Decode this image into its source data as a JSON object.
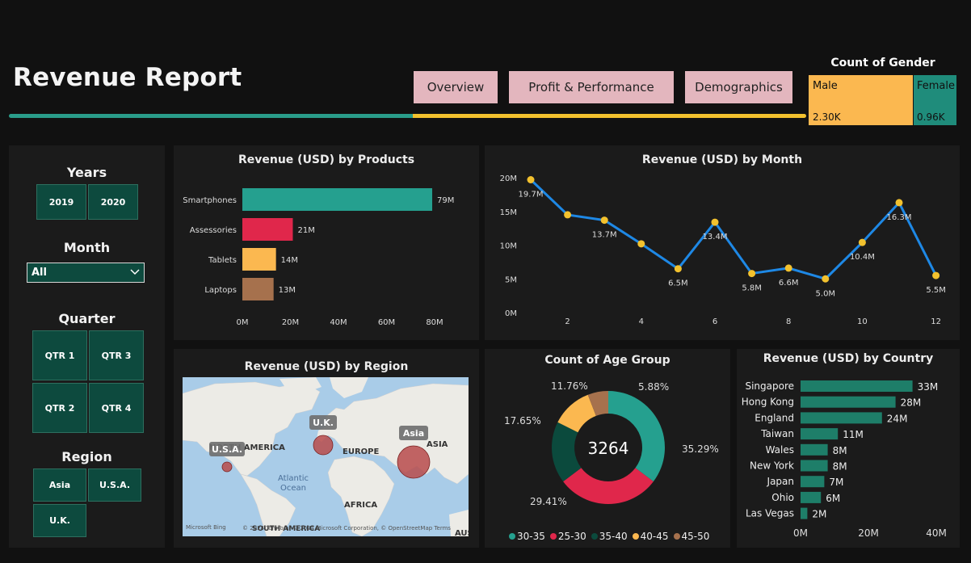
{
  "header": {
    "title": "Revenue Report",
    "nav": [
      "Overview",
      "Profit & Performance",
      "Demographics"
    ]
  },
  "gender": {
    "title": "Count of Gender",
    "male_label": "Male",
    "male_value": "2.30K",
    "female_label": "Female",
    "female_value": "0.96K",
    "male_color": "#fbb850",
    "female_color": "#1f8c7b"
  },
  "slicers": {
    "years_label": "Years",
    "years": [
      "2019",
      "2020"
    ],
    "month_label": "Month",
    "month_value": "All",
    "quarter_label": "Quarter",
    "quarters": [
      "QTR 1",
      "QTR 3",
      "QTR 2",
      "QTR 4"
    ],
    "region_label": "Region",
    "regions": [
      "Asia",
      "U.S.A.",
      "U.K."
    ]
  },
  "map": {
    "title": "Revenue (USD) by Region",
    "labels": {
      "na": "NORTH AMERICA",
      "eu": "EUROPE",
      "as": "ASIA",
      "af": "AFRICA",
      "sa": "SOUTH AMERICA",
      "ocean": "Atlantic\nOcean",
      "aus": "AUS"
    },
    "bubbles": [
      "U.S.A.",
      "U.K.",
      "Asia"
    ],
    "attribution": "© 2024 TomTom, © 2024 Microsoft Corporation, © OpenStreetMap  Terms",
    "bing": "Microsoft Bing"
  },
  "chart_data": [
    {
      "type": "bar",
      "title": "Revenue (USD) by Products",
      "categories": [
        "Smartphones",
        "Assessories",
        "Tablets",
        "Laptops"
      ],
      "values": [
        79,
        21,
        14,
        13
      ],
      "data_labels": [
        "79M",
        "21M",
        "14M",
        "13M"
      ],
      "colors": [
        "#25a08f",
        "#e0274b",
        "#fbb850",
        "#a6714d"
      ],
      "x_ticks": [
        "0M",
        "20M",
        "40M",
        "60M",
        "80M"
      ],
      "xlim": [
        0,
        80
      ],
      "unit": "M"
    },
    {
      "type": "line",
      "title": "Revenue (USD) by Month",
      "x": [
        1,
        2,
        3,
        4,
        5,
        6,
        7,
        8,
        9,
        10,
        11,
        12
      ],
      "values": [
        19.7,
        14.5,
        13.7,
        10.2,
        6.5,
        13.4,
        5.8,
        6.6,
        5.0,
        10.4,
        16.3,
        5.5
      ],
      "point_labels": {
        "0": "19.7M",
        "2": "13.7M",
        "4": "6.5M",
        "5": "13.4M",
        "6": "5.8M",
        "7": "6.6M",
        "8": "5.0M",
        "9": "10.4M",
        "10": "16.3M",
        "11": "5.5M"
      },
      "y_ticks": [
        "0M",
        "5M",
        "10M",
        "15M",
        "20M"
      ],
      "x_ticks": [
        "2",
        "4",
        "6",
        "8",
        "10",
        "12"
      ],
      "ylim": [
        0,
        20
      ],
      "line_color": "#1e88e5",
      "point_color": "#f2c12e"
    },
    {
      "type": "pie",
      "title": "Count of Age Group",
      "center_label": "3264",
      "categories": [
        "30-35",
        "25-30",
        "35-40",
        "40-45",
        "45-50"
      ],
      "values": [
        35.29,
        29.41,
        17.65,
        11.76,
        5.88
      ],
      "labels": [
        "35.29%",
        "29.41%",
        "17.65%",
        "11.76%",
        "5.88%"
      ],
      "colors": [
        "#25a08f",
        "#e0274b",
        "#0b4a3d",
        "#fbb850",
        "#a6714d"
      ]
    },
    {
      "type": "bar",
      "title": "Revenue (USD) by Country",
      "categories": [
        "Singapore",
        "Hong Kong",
        "England",
        "Taiwan",
        "Wales",
        "New York",
        "Japan",
        "Ohio",
        "Las Vegas"
      ],
      "values": [
        33,
        28,
        24,
        11,
        8,
        8,
        7,
        6,
        2
      ],
      "data_labels": [
        "33M",
        "28M",
        "24M",
        "11M",
        "8M",
        "8M",
        "7M",
        "6M",
        "2M"
      ],
      "color": "#1e7e69",
      "x_ticks": [
        "0M",
        "20M",
        "40M"
      ],
      "xlim": [
        0,
        40
      ],
      "unit": "M"
    }
  ]
}
